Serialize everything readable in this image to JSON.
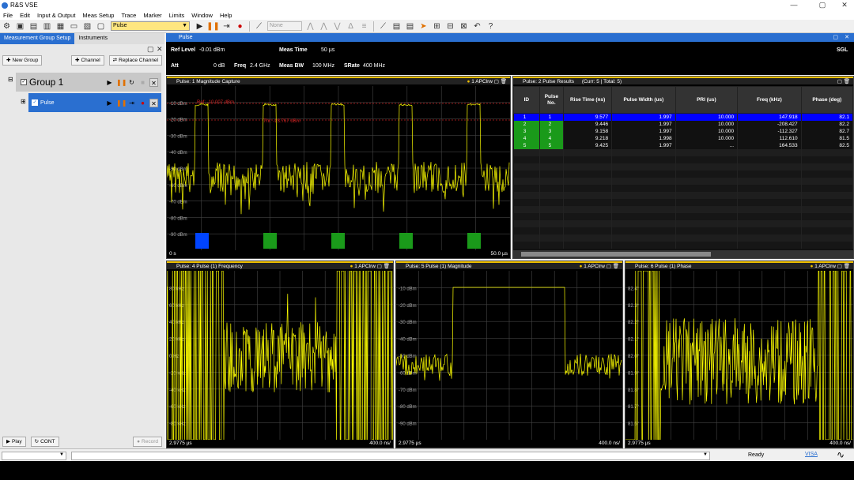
{
  "window": {
    "title": "R&S VSE",
    "minimize": "—",
    "maximize": "▢",
    "close": "✕"
  },
  "menu": [
    "File",
    "Edit",
    "Input & Output",
    "Meas Setup",
    "Trace",
    "Marker",
    "Limits",
    "Window",
    "Help"
  ],
  "toolbar": {
    "measurement": "Pulse",
    "marker_mode": "None"
  },
  "left": {
    "tabs": [
      "Measurement Group Setup",
      "Instruments"
    ],
    "new_group": "New Group",
    "channel": "Channel",
    "replace_channel": "Replace Channel",
    "group": "Group 1",
    "pulse": "Pulse",
    "play": "Play",
    "cont": "CONT",
    "record": "Record"
  },
  "main": {
    "tab": "Pulse",
    "sgl": "SGL"
  },
  "info": {
    "ref_level_label": "Ref Level",
    "ref_level": "-0.01 dBm",
    "meas_time_label": "Meas Time",
    "meas_time": "50 µs",
    "att_label": "Att",
    "att": "0 dB",
    "freq_label": "Freq",
    "freq": "2.4 GHz",
    "meas_bw_label": "Meas BW",
    "meas_bw": "100 MHz",
    "srate_label": "SRate",
    "srate": "400 MHz"
  },
  "windows": {
    "w1": {
      "title": "Pulse: 1 Magnitude Capture",
      "trace": "1 APClrw",
      "start": "0 s",
      "stop": "50.0 µs",
      "y_labels": [
        "-10 dBm",
        "-20 dBm",
        "-30 dBm",
        "-40 dBm",
        "-50 dBm",
        "-60 dBm",
        "-70 dBm",
        "-80 dBm",
        "-90 dBm"
      ],
      "ref_label": "Ref: -10.007 dBm",
      "thr_label": "Thr: -23.767 dBm"
    },
    "w2": {
      "title": "Pulse: 2 Pulse Results",
      "sub": "(Curr: 5 | Total: 5)"
    },
    "w4": {
      "title": "Pulse: 4 Pulse (1) Frequency",
      "trace": "1 APClrw",
      "start": "2.9775 µs",
      "stop": "400.0 ns/",
      "y_labels": [
        "80 kHz",
        "60 kHz",
        "40 kHz",
        "20 kHz",
        "0 Hz",
        "-20 kHz",
        "-40 kHz",
        "-60 kHz",
        "-80 kHz"
      ]
    },
    "w5": {
      "title": "Pulse: 5 Pulse (1) Magnitude",
      "trace": "1 APClrw",
      "start": "2.9775 µs",
      "stop": "400.0 ns/",
      "y_labels": [
        "-10 dBm",
        "-20 dBm",
        "-30 dBm",
        "-40 dBm",
        "-50 dBm",
        "-60 dBm",
        "-70 dBm",
        "-80 dBm",
        "-90 dBm"
      ]
    },
    "w6": {
      "title": "Pulse: 6 Pulse (1) Phase",
      "trace": "1 APClrw",
      "start": "2.9775 µs",
      "stop": "400.0 ns/",
      "y_labels": [
        "82.4°",
        "82.3°",
        "82.2°",
        "82.1°",
        "82.0°",
        "81.9°",
        "81.8°",
        "81.7°",
        "81.6°"
      ]
    }
  },
  "table": {
    "headers": [
      "ID",
      "Pulse No.",
      "Rise Time (ns)",
      "Pulse Width (us)",
      "PRI (us)",
      "Freq (kHz)",
      "Phase (deg)"
    ],
    "rows": [
      [
        "1",
        "1",
        "9.577",
        "1.997",
        "10.000",
        "147.918",
        "82.1"
      ],
      [
        "2",
        "2",
        "9.446",
        "1.997",
        "10.000",
        "-208.427",
        "82.2"
      ],
      [
        "3",
        "3",
        "9.158",
        "1.997",
        "10.000",
        "-112.327",
        "82.7"
      ],
      [
        "4",
        "4",
        "9.218",
        "1.998",
        "10.000",
        "112.610",
        "81.5"
      ],
      [
        "5",
        "5",
        "9.425",
        "1.997",
        "...",
        "164.533",
        "82.5"
      ]
    ]
  },
  "status": {
    "ready": "Ready",
    "brand": "VISA"
  },
  "colors": {
    "accent": "#2a6fd0",
    "trace": "#ffff00",
    "selected_row": "#0000ff",
    "green": "#1a9a1a",
    "ref_line": "#cc2222"
  }
}
